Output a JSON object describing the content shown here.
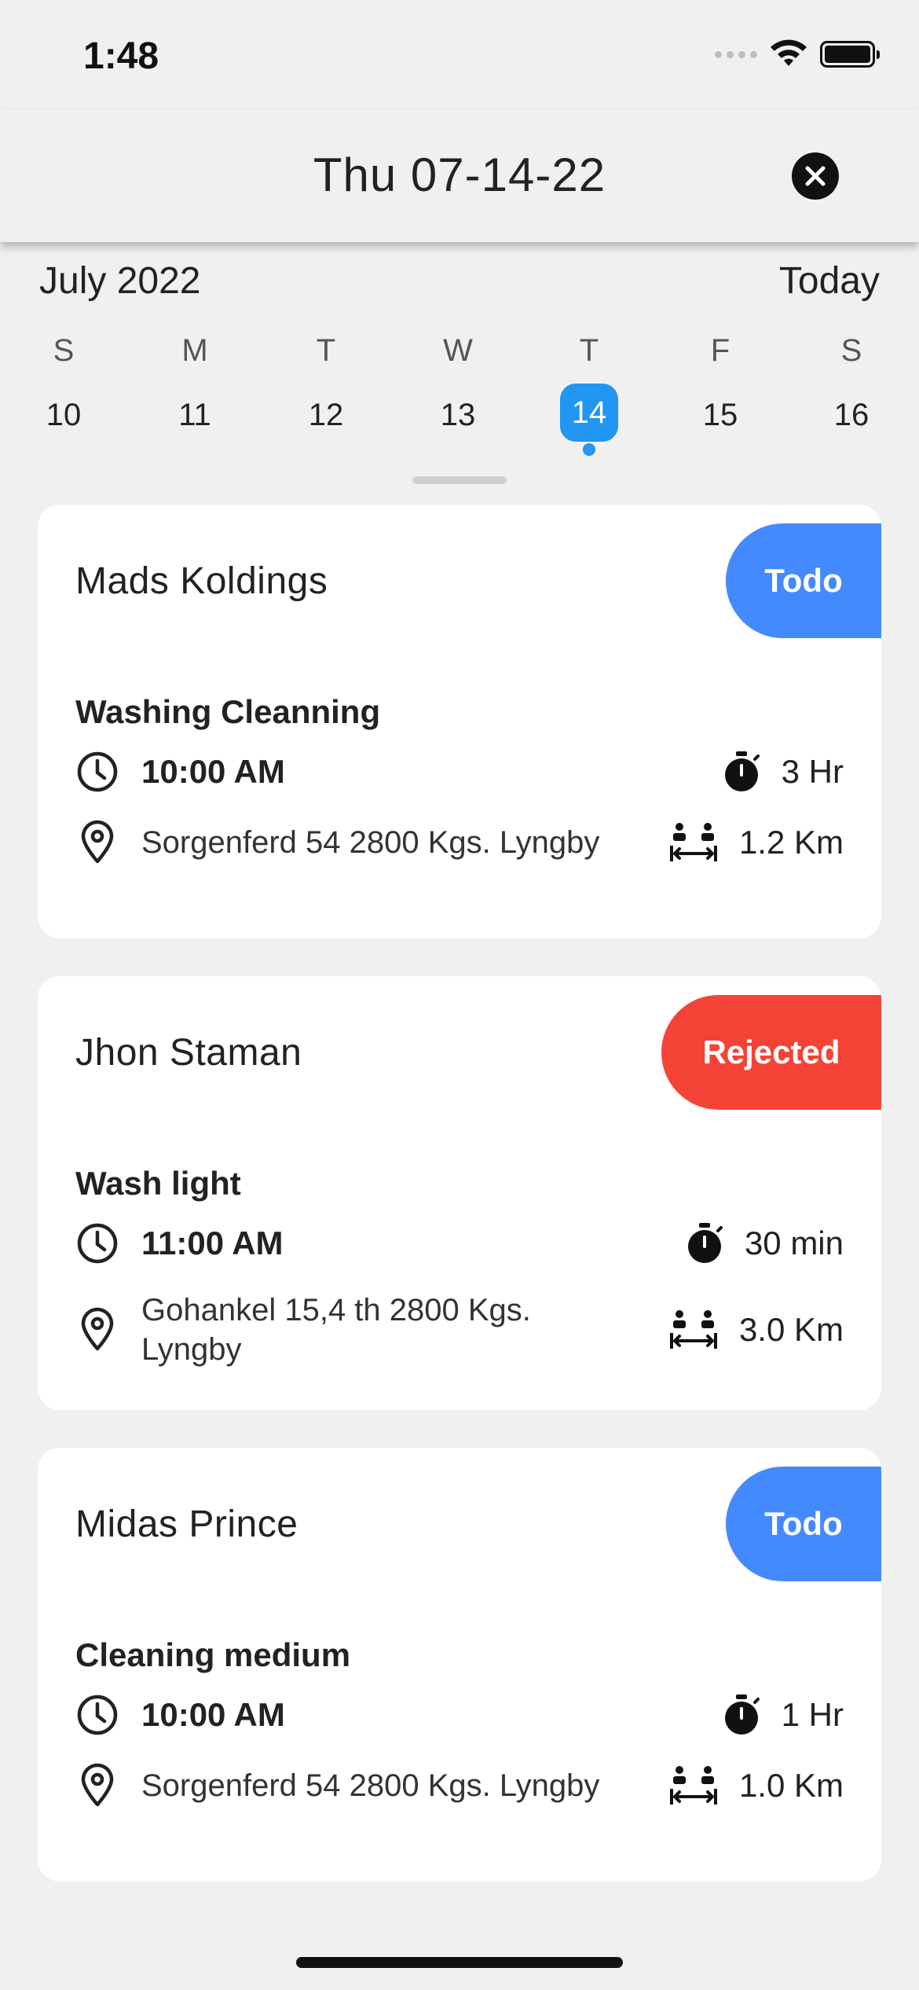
{
  "status_bar": {
    "time": "1:48"
  },
  "header": {
    "title": "Thu 07-14-22"
  },
  "calendar": {
    "month_label": "July 2022",
    "today_label": "Today",
    "weekdays": [
      "S",
      "M",
      "T",
      "W",
      "T",
      "F",
      "S"
    ],
    "dates": [
      "10",
      "11",
      "12",
      "13",
      "14",
      "15",
      "16"
    ],
    "selected_date": "14"
  },
  "colors": {
    "accent": "#2196f3",
    "todo": "#448aff",
    "rejected": "#f44336"
  },
  "jobs": [
    {
      "customer": "Mads Koldings",
      "status": "Todo",
      "service": "Washing Cleanning",
      "time": "10:00 AM",
      "duration": "3 Hr",
      "address": "Sorgenferd 54 2800 Kgs. Lyngby",
      "distance": "1.2 Km"
    },
    {
      "customer": "Jhon Staman",
      "status": "Rejected",
      "service": "Wash light",
      "time": "11:00 AM",
      "duration": "30 min",
      "address": "Gohankel 15,4 th 2800 Kgs. Lyngby",
      "distance": "3.0 Km"
    },
    {
      "customer": "Midas Prince",
      "status": "Todo",
      "service": "Cleaning medium",
      "time": "10:00 AM",
      "duration": "1 Hr",
      "address": "Sorgenferd 54 2800 Kgs. Lyngby",
      "distance": "1.0 Km"
    }
  ]
}
